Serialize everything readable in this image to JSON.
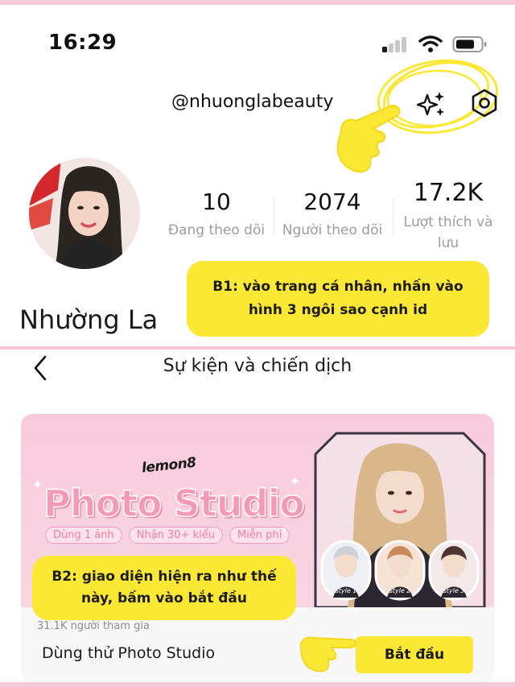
{
  "status_bar": {
    "time": "16:29"
  },
  "profile": {
    "username": "@nhuonglabeauty",
    "display_name": "Nhường La",
    "stats": [
      {
        "value": "10",
        "label": "Đang theo dõi"
      },
      {
        "value": "2074",
        "label": "Người theo dõi"
      },
      {
        "value": "17.2K",
        "label": "Lượt thích và lưu"
      }
    ]
  },
  "annotations": {
    "step1": "B1: vào trang cá nhân, nhấn vào hình 3 ngôi sao cạnh id",
    "step2": "B2: giao diện hiện ra như thế này, bấm vào bắt đầu"
  },
  "event_page": {
    "title": "Sự kiện và chiến dịch",
    "banner": {
      "logo": "lemon8",
      "headline": "Photo Studio",
      "pills": [
        "Dùng 1 ảnh",
        "Nhận 30+ kiểu",
        "Miễn phí"
      ],
      "styles": [
        "style 1",
        "style 2",
        "style 3"
      ]
    },
    "participants": "31.1K người tham gia",
    "card_title": "Dùng thử Photo Studio",
    "start_label": "Bắt đầu"
  },
  "colors": {
    "accent_yellow": "#fbe834",
    "brand_pink": "#f49ab6",
    "frame_pink": "#f6c9d8"
  }
}
